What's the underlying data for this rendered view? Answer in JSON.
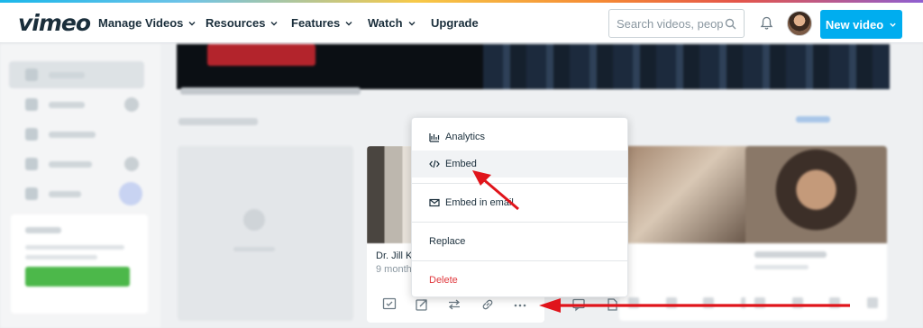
{
  "app": {
    "logo_text": "vimeo"
  },
  "nav": {
    "items": [
      {
        "label": "Manage Videos",
        "has_dropdown": true
      },
      {
        "label": "Resources",
        "has_dropdown": true
      },
      {
        "label": "Features",
        "has_dropdown": true
      },
      {
        "label": "Watch",
        "has_dropdown": true
      },
      {
        "label": "Upgrade",
        "has_dropdown": false
      }
    ],
    "search": {
      "placeholder": "Search videos, peopl",
      "value": ""
    },
    "new_video_label": "New video",
    "accent_color": "#00adef"
  },
  "focused_video": {
    "title": "Dr. Jill K",
    "meta": "9 months"
  },
  "context_menu": {
    "items": [
      {
        "label": "Analytics",
        "icon": "analytics-icon"
      },
      {
        "label": "Embed",
        "icon": "code-icon"
      },
      {
        "label": "Embed in email",
        "icon": "email-icon"
      },
      {
        "label": "Replace",
        "icon": null
      },
      {
        "label": "Delete",
        "icon": null,
        "color": "#e0393e"
      }
    ]
  },
  "video_actions": [
    "check-icon",
    "share-icon",
    "swap-icon",
    "link-icon",
    "more-icon"
  ],
  "annotation_color": "#e0141b"
}
